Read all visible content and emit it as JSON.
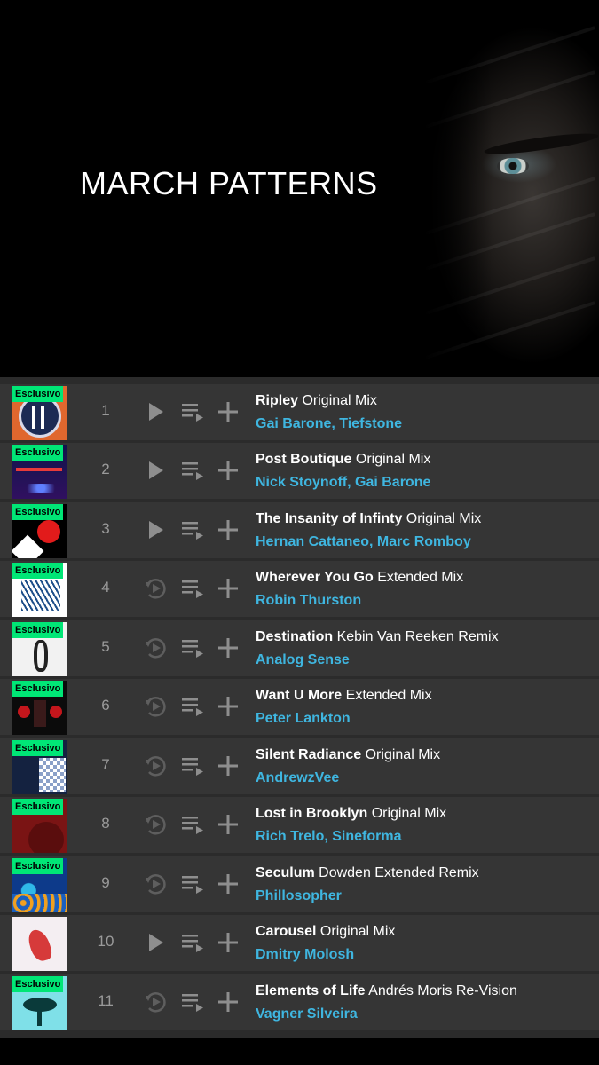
{
  "hero": {
    "title": "MARCH PATTERNS"
  },
  "badge_label": "Esclusivo",
  "colors": {
    "accent_artist": "#3fb6e0",
    "badge": "#00e676",
    "row_bg": "#353535",
    "list_bg": "#2b2b2b"
  },
  "tracks": [
    {
      "number": "1",
      "title": "Ripley",
      "mix": "Original Mix",
      "artists": "Gai Barone, Tiefstone",
      "exclusive": true,
      "playable": true,
      "cover": "navy-circle"
    },
    {
      "number": "2",
      "title": "Post Boutique",
      "mix": "Original Mix",
      "artists": "Nick Stoynoff, Gai Barone",
      "exclusive": true,
      "playable": true,
      "cover": "blue-red-lights"
    },
    {
      "number": "3",
      "title": "The Insanity of Infinty",
      "mix": "Original Mix",
      "artists": "Hernan Cattaneo, Marc Romboy",
      "exclusive": true,
      "playable": true,
      "cover": "red-dot-black"
    },
    {
      "number": "4",
      "title": "Wherever You Go",
      "mix": "Extended Mix",
      "artists": "Robin Thurston",
      "exclusive": true,
      "playable": false,
      "cover": "blue-waves"
    },
    {
      "number": "5",
      "title": "Destination",
      "mix": "Kebin Van Reeken Remix",
      "artists": "Analog Sense",
      "exclusive": true,
      "playable": false,
      "cover": "white-sculpture"
    },
    {
      "number": "6",
      "title": "Want U More",
      "mix": "Extended Mix",
      "artists": "Peter Lankton",
      "exclusive": true,
      "playable": false,
      "cover": "red-roses"
    },
    {
      "number": "7",
      "title": "Silent Radiance",
      "mix": "Original Mix",
      "artists": "AndrewzVee",
      "exclusive": true,
      "playable": false,
      "cover": "navy-pattern"
    },
    {
      "number": "8",
      "title": "Lost in Brooklyn",
      "mix": "Original Mix",
      "artists": "Rich Trelo, Sineforma",
      "exclusive": true,
      "playable": false,
      "cover": "dark-red"
    },
    {
      "number": "9",
      "title": "Seculum",
      "mix": "Dowden Extended Remix",
      "artists": "Phillosopher",
      "exclusive": true,
      "playable": false,
      "cover": "blue-cells"
    },
    {
      "number": "10",
      "title": "Carousel",
      "mix": "Original Mix",
      "artists": "Dmitry Molosh",
      "exclusive": false,
      "playable": true,
      "cover": "red-horse"
    },
    {
      "number": "11",
      "title": "Elements of Life",
      "mix": "Andrés Moris Re-Vision",
      "artists": "Vagner Silveira",
      "exclusive": true,
      "playable": false,
      "cover": "cyan-tree"
    }
  ]
}
